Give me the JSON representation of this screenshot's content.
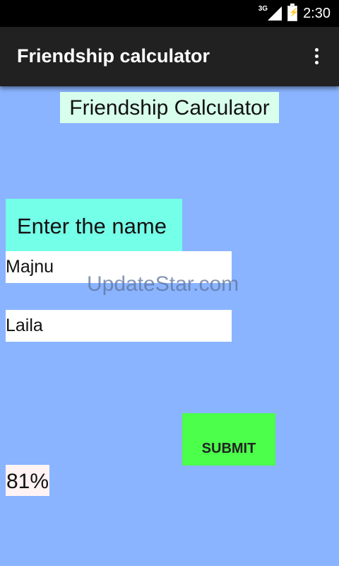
{
  "status_bar": {
    "network": "3G",
    "time": "2:30",
    "icons": [
      "signal-icon",
      "battery-charging-icon"
    ]
  },
  "action_bar": {
    "title": "Friendship calculator",
    "menu_icon": "overflow-menu-icon"
  },
  "main": {
    "heading": "Friendship Calculator",
    "prompt": "Enter the name",
    "name1_value": "Majnu",
    "name2_value": "Laila",
    "watermark": "UpdateStar.com",
    "submit_label": "SUBMIT",
    "result": "81%"
  },
  "colors": {
    "background": "#8ab4ff",
    "action_bar": "#212121",
    "heading_bg": "#d8ffec",
    "prompt_bg": "#74ffe8",
    "submit_bg": "#4bff4b",
    "result_bg": "#fff3f3"
  }
}
